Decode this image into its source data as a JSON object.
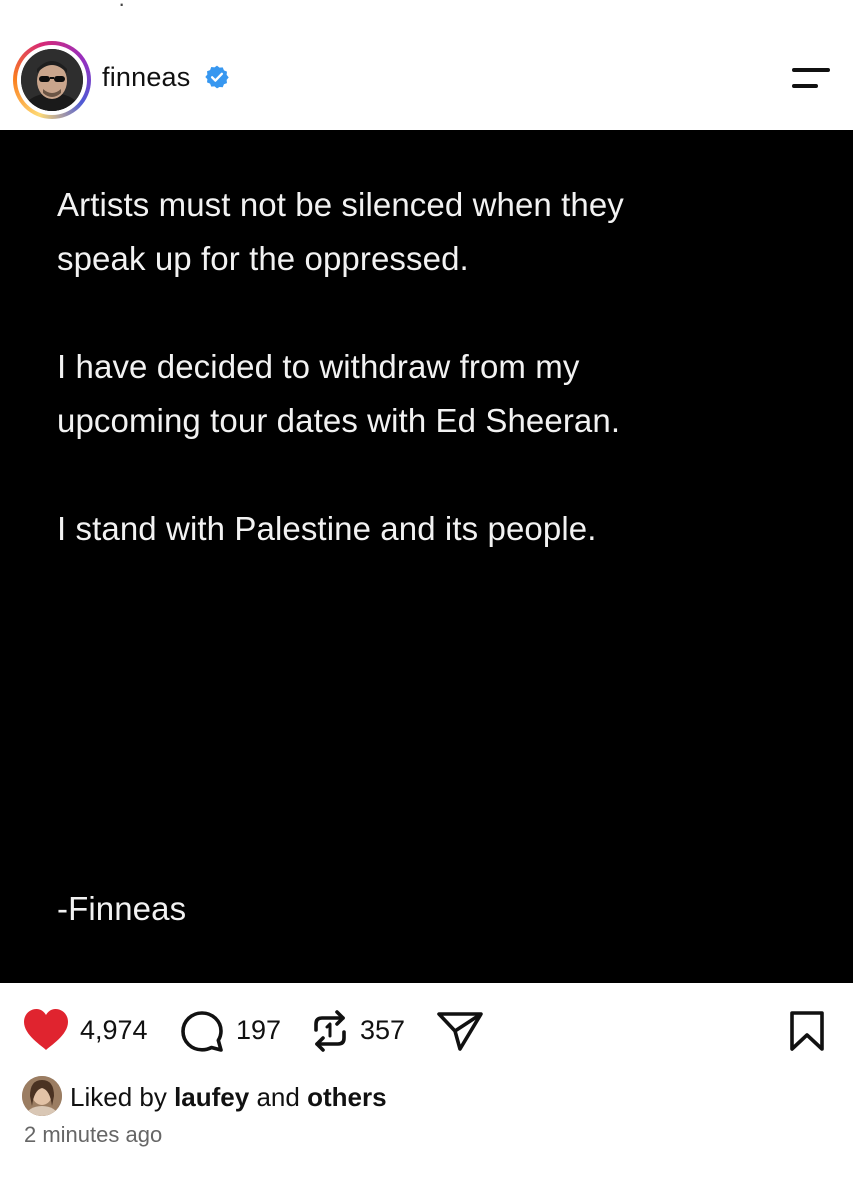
{
  "header": {
    "username": "finneas",
    "verified": true
  },
  "post": {
    "background": "#000000",
    "lines": [
      "Artists must not be silenced when they",
      "speak up for the oppressed.",
      "I have decided to withdraw from my",
      "upcoming tour dates with Ed Sheeran.",
      "I stand with Palestine and its people."
    ],
    "signature": "-Finneas"
  },
  "actions": {
    "likes_count": "4,974",
    "comments_count": "197",
    "reposts_count": "357",
    "like_color": "#e0242f"
  },
  "liked_by": {
    "prefix": "Liked by",
    "user": "laufey",
    "and": "and",
    "others": "others"
  },
  "timestamp": "2 minutes ago",
  "colors": {
    "verified": "#3797f0",
    "text": "#111111",
    "muted": "#666666"
  }
}
